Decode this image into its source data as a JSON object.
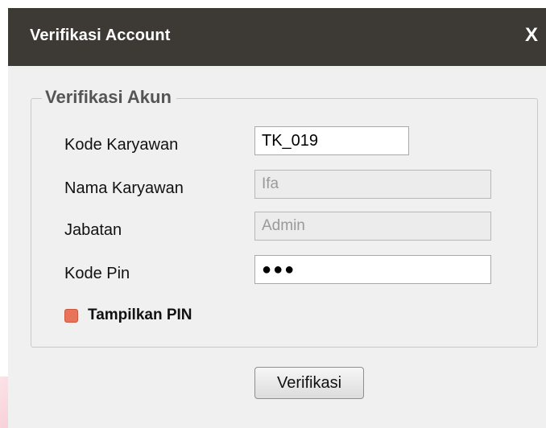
{
  "dialog": {
    "title": "Verifikasi Account",
    "close_label": "X"
  },
  "group": {
    "legend": "Verifikasi Akun"
  },
  "fields": {
    "kode_karyawan": {
      "label": "Kode Karyawan",
      "value": "TK_019"
    },
    "nama_karyawan": {
      "label": "Nama Karyawan",
      "value": "Ifa"
    },
    "jabatan": {
      "label": "Jabatan",
      "value": "Admin"
    },
    "kode_pin": {
      "label": "Kode Pin",
      "value": "●●●"
    }
  },
  "show_pin": {
    "label": "Tampilkan PIN",
    "color": "#e8735a"
  },
  "actions": {
    "verify_label": "Verifikasi"
  },
  "colors": {
    "titlebar": "#3d3a35",
    "window": "#f0f0f0"
  }
}
